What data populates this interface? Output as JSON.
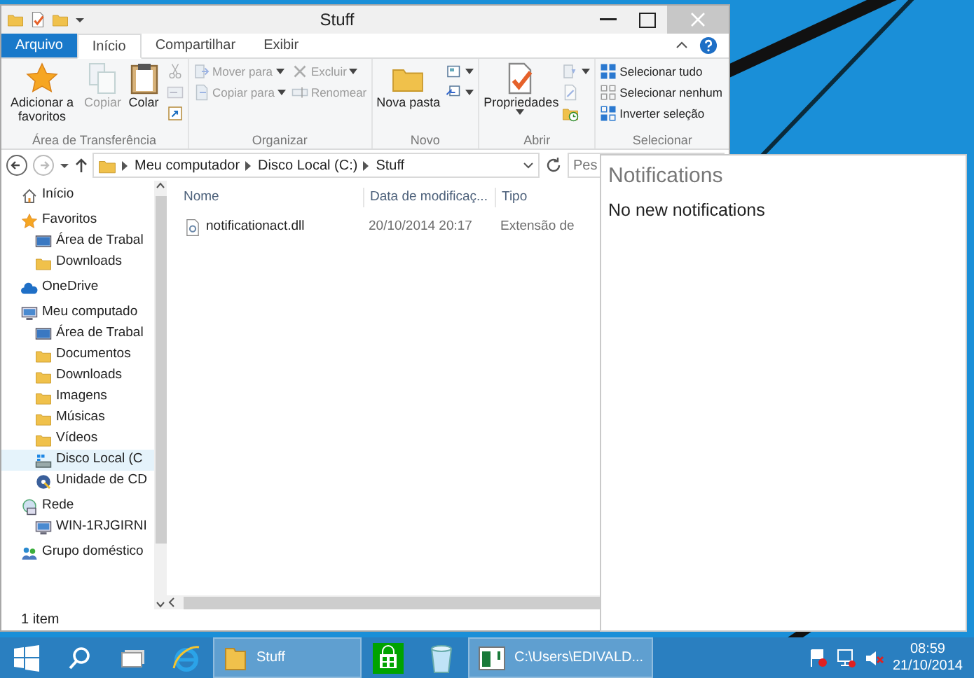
{
  "explorer": {
    "title": "Stuff",
    "tabs": [
      {
        "label": "Arquivo",
        "kind": "file",
        "selected": false
      },
      {
        "label": "Início",
        "kind": "tab",
        "selected": true
      },
      {
        "label": "Compartilhar",
        "kind": "tab",
        "selected": false
      },
      {
        "label": "Exibir",
        "kind": "tab",
        "selected": false
      }
    ],
    "ribbon_groups": [
      {
        "label": "Área de Transferência",
        "items": [
          {
            "kind": "large",
            "label": "Adicionar a favoritos",
            "disabled": false,
            "dropdown": false
          },
          {
            "kind": "large",
            "label": "Copiar",
            "disabled": true,
            "dropdown": false
          },
          {
            "kind": "large",
            "label": "Colar",
            "disabled": false,
            "dropdown": false
          },
          {
            "kind": "column",
            "items": [
              {
                "kind": "icon",
                "disabled": true,
                "dropdown": false
              },
              {
                "kind": "icon",
                "disabled": true,
                "dropdown": false
              },
              {
                "kind": "icon",
                "disabled": false,
                "dropdown": false
              }
            ]
          }
        ]
      },
      {
        "label": "Organizar",
        "items": [
          {
            "kind": "column",
            "items": [
              {
                "kind": "small",
                "label": "Mover para",
                "disabled": true,
                "dropdown": true
              },
              {
                "kind": "small",
                "label": "Copiar para",
                "disabled": true,
                "dropdown": true
              }
            ]
          },
          {
            "kind": "column",
            "items": [
              {
                "kind": "small",
                "label": "Excluir",
                "disabled": true,
                "dropdown": true
              },
              {
                "kind": "small",
                "label": "Renomear",
                "disabled": true,
                "dropdown": false
              }
            ]
          }
        ]
      },
      {
        "label": "Novo",
        "items": [
          {
            "kind": "large",
            "label": "Nova pasta",
            "disabled": false,
            "dropdown": false
          },
          {
            "kind": "column",
            "items": [
              {
                "kind": "icon",
                "disabled": false,
                "dropdown": true
              },
              {
                "kind": "icon",
                "disabled": false,
                "dropdown": true
              }
            ]
          }
        ]
      },
      {
        "label": "Abrir",
        "items": [
          {
            "kind": "large",
            "label": "Propriedades",
            "disabled": false,
            "dropdown": true
          },
          {
            "kind": "column",
            "items": [
              {
                "kind": "icon",
                "disabled": true,
                "dropdown": true
              },
              {
                "kind": "icon",
                "disabled": true,
                "dropdown": false
              },
              {
                "kind": "icon",
                "disabled": false,
                "dropdown": false
              }
            ]
          }
        ]
      },
      {
        "label": "Selecionar",
        "items": [
          {
            "kind": "column",
            "items": [
              {
                "kind": "small",
                "label": "Selecionar tudo",
                "disabled": false,
                "dropdown": false
              },
              {
                "kind": "small",
                "label": "Selecionar nenhum",
                "disabled": false,
                "dropdown": false
              },
              {
                "kind": "small",
                "label": "Inverter seleção",
                "disabled": false,
                "dropdown": false
              }
            ]
          }
        ]
      }
    ],
    "breadcrumb": [
      "Meu computador",
      "Disco Local (C:)",
      "Stuff"
    ],
    "search": {
      "placeholder": "Pes"
    },
    "nav": [
      {
        "label": "Início",
        "selected": false
      },
      {
        "label": "Favoritos",
        "selected": false,
        "children": [
          {
            "label": "Área de Trabal",
            "selected": false
          },
          {
            "label": "Downloads",
            "selected": false
          }
        ]
      },
      {
        "label": "OneDrive",
        "selected": false
      },
      {
        "label": "Meu computado",
        "selected": false,
        "children": [
          {
            "label": "Área de Trabal",
            "selected": false
          },
          {
            "label": "Documentos",
            "selected": false
          },
          {
            "label": "Downloads",
            "selected": false
          },
          {
            "label": "Imagens",
            "selected": false
          },
          {
            "label": "Músicas",
            "selected": false
          },
          {
            "label": "Vídeos",
            "selected": false
          },
          {
            "label": "Disco Local (C",
            "selected": true
          },
          {
            "label": "Unidade de CD",
            "selected": false
          }
        ]
      },
      {
        "label": "Rede",
        "selected": false,
        "children": [
          {
            "label": "WIN-1RJGIRNI",
            "selected": false
          }
        ]
      },
      {
        "label": "Grupo doméstico",
        "selected": false
      }
    ],
    "columns": [
      "Nome",
      "Data de modificaç...",
      "Tipo"
    ],
    "rows": [
      [
        "notificationact.dll",
        "20/10/2014 20:17",
        "Extensão de"
      ]
    ],
    "status_bar": "1 item"
  },
  "notifications": {
    "title": "Notifications",
    "message": "No new notifications"
  },
  "taskbar": {
    "items": [
      {
        "kind": "start",
        "selected": false
      },
      {
        "kind": "search",
        "selected": false
      },
      {
        "kind": "taskview",
        "selected": false
      },
      {
        "kind": "browser",
        "selected": false
      },
      {
        "kind": "folder",
        "label": "Stuff",
        "selected": true
      },
      {
        "kind": "store",
        "selected": false
      },
      {
        "kind": "recycle",
        "selected": false
      },
      {
        "kind": "console",
        "label": "C:\\Users\\EDIVALD...",
        "selected": true
      }
    ],
    "time": "08:59",
    "date": "21/10/2014"
  }
}
